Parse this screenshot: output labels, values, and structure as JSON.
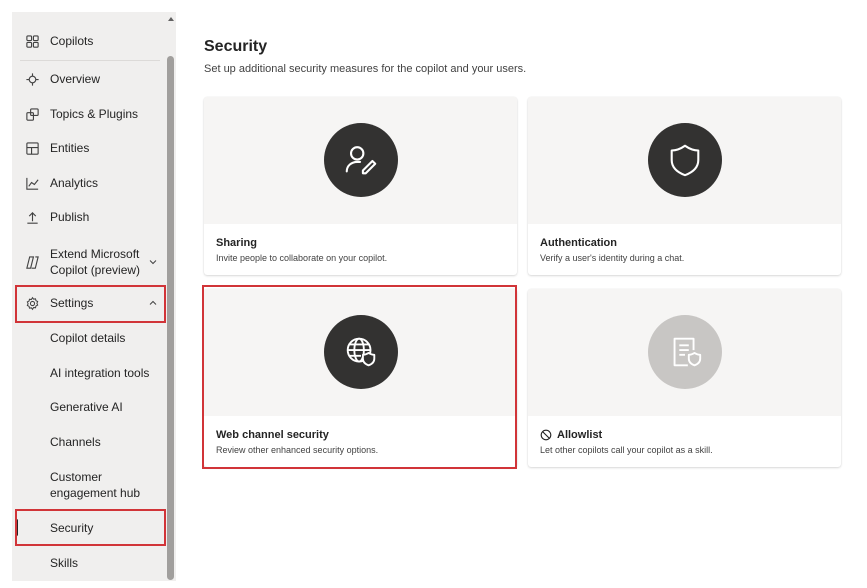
{
  "sidebar": {
    "header": {
      "label": "Copilots",
      "icon": "grid-icon"
    },
    "items": [
      {
        "label": "Overview",
        "icon": "overview-icon"
      },
      {
        "label": "Topics & Plugins",
        "icon": "topics-icon"
      },
      {
        "label": "Entities",
        "icon": "entities-icon"
      },
      {
        "label": "Analytics",
        "icon": "analytics-icon"
      },
      {
        "label": "Publish",
        "icon": "publish-icon"
      },
      {
        "label_line1": "Extend Microsoft",
        "label_line2": "Copilot (preview)",
        "icon": "copilot-icon",
        "expanded": false
      },
      {
        "label": "Settings",
        "icon": "gear-icon",
        "expanded": true
      }
    ],
    "settings_children": [
      {
        "label": "Copilot details"
      },
      {
        "label": "AI integration tools"
      },
      {
        "label": "Generative AI"
      },
      {
        "label": "Channels"
      },
      {
        "label_line1": "Customer",
        "label_line2": "engagement hub"
      },
      {
        "label": "Security",
        "selected": true
      },
      {
        "label": "Skills"
      }
    ]
  },
  "main": {
    "title": "Security",
    "subtitle": "Set up additional security measures for the copilot and your users.",
    "cards": [
      {
        "title": "Sharing",
        "description": "Invite people to collaborate on your copilot.",
        "icon": "person-edit-icon",
        "enabled": true
      },
      {
        "title": "Authentication",
        "description": "Verify a user's identity during a chat.",
        "icon": "shield-icon",
        "enabled": true
      },
      {
        "title": "Web channel security",
        "description": "Review other enhanced security options.",
        "icon": "globe-shield-icon",
        "enabled": true
      },
      {
        "title": "Allowlist",
        "description": "Let other copilots call your copilot as a skill.",
        "icon": "document-shield-icon",
        "enabled": false,
        "title_icon": "prohibited-icon"
      }
    ]
  },
  "colors": {
    "sidebar_bg": "#f0efee",
    "icon_circle": "#333231",
    "icon_circle_disabled": "#c8c6c4",
    "highlight": "#d13438"
  }
}
